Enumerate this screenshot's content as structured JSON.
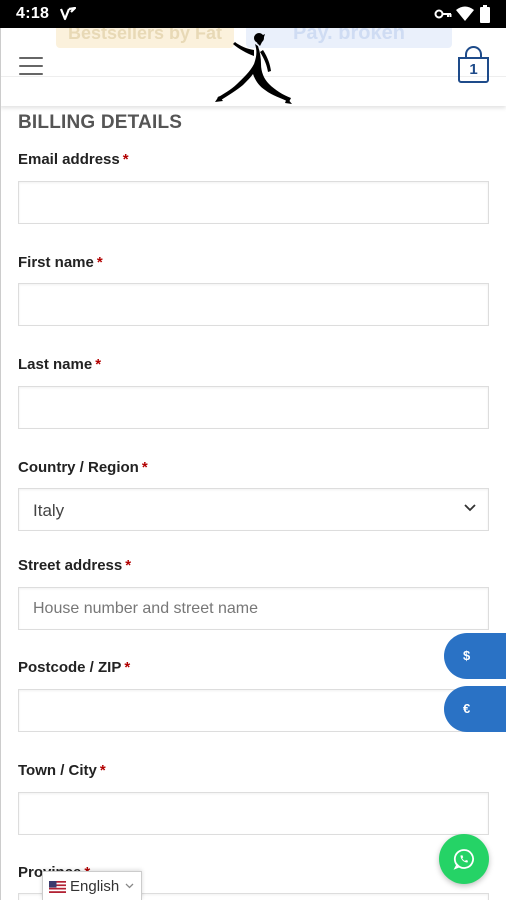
{
  "status_bar": {
    "time": "4:18"
  },
  "header": {
    "promo_left": "Bestsellers by Fat",
    "promo_right": "Pay. broken",
    "cart_count": "1"
  },
  "form": {
    "title": "BILLING DETAILS",
    "required_mark": "*",
    "fields": [
      {
        "label": "Email address",
        "value": ""
      },
      {
        "label": "First name",
        "value": ""
      },
      {
        "label": "Last name",
        "value": ""
      },
      {
        "label": "Country / Region",
        "value": "Italy"
      },
      {
        "label": "Street address",
        "placeholder": "House number and street name"
      },
      {
        "label": "Postcode / ZIP",
        "value": ""
      },
      {
        "label": "Town / City",
        "value": ""
      },
      {
        "label": "Province"
      }
    ]
  },
  "currency": {
    "dollar": "$",
    "euro": "€"
  },
  "language": {
    "selected": "English"
  },
  "colors": {
    "accent": "#1e4b8a",
    "required": "#b20000",
    "currency_button": "#2a72c5",
    "whatsapp": "#25d366"
  }
}
